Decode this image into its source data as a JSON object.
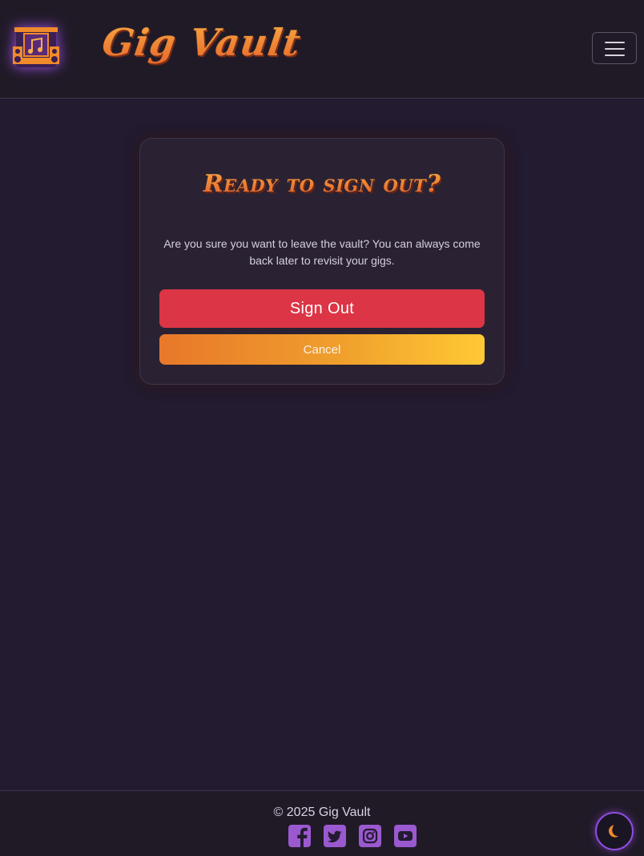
{
  "navbar": {
    "brand": "Gig Vault",
    "logo_icon": "stage-music-icon",
    "menu_icon": "hamburger-menu-icon"
  },
  "card": {
    "title": "Ready to sign out?",
    "message": "Are you sure you want to leave the vault? You can always come back later to revisit your gigs.",
    "sign_out_label": "Sign Out",
    "cancel_label": "Cancel"
  },
  "footer": {
    "copyright": "© 2025 Gig Vault",
    "social": [
      "facebook-icon",
      "twitter-icon",
      "instagram-icon",
      "youtube-icon"
    ]
  },
  "theme_toggle": {
    "icon": "moon-icon"
  },
  "colors": {
    "background": "#231b30",
    "accent_orange": "#e8692a",
    "accent_purple": "#8f4de0",
    "danger": "#dc3545",
    "social": "#9b59d0"
  }
}
